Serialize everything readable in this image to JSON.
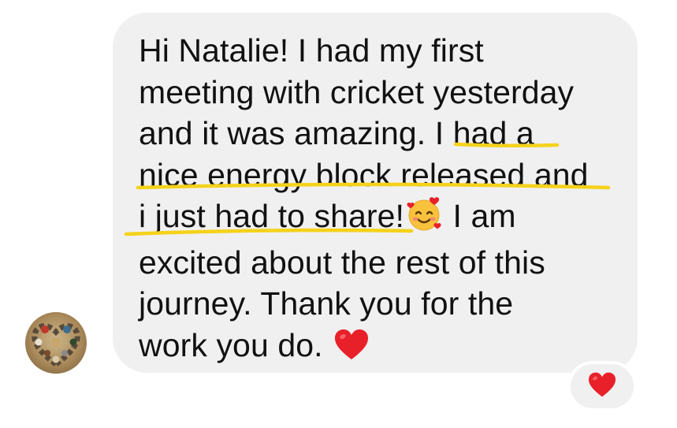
{
  "message": {
    "lines": [
      "Hi Natalie! I had my first",
      "meeting with cricket yesterday",
      "and it was amazing. ",
      "I had a",
      "nice energy block released and",
      "i just had to share!",
      " I am",
      "excited about the rest of this",
      "journey. Thank you for the",
      "work you do. "
    ],
    "inline_emojis": [
      "smiling-face-with-hearts-icon",
      "red-heart-icon"
    ]
  },
  "reaction": {
    "icon": "red-heart-icon"
  },
  "colors": {
    "bubble": "#f0f0f0",
    "highlight": "#f5d21a",
    "heart": "#e8202a",
    "text": "#111111"
  }
}
